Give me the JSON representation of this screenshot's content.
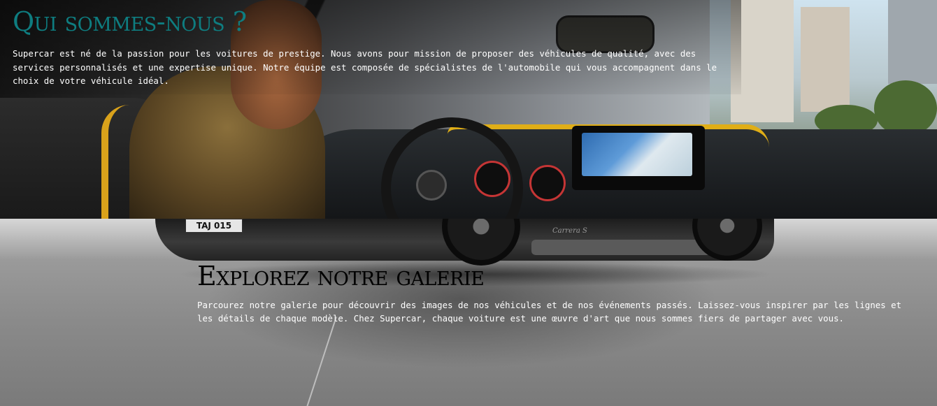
{
  "about": {
    "title": "Qui sommes-nous ?",
    "text": "Supercar est né de la passion pour les voitures de prestige. Nous avons pour mission de proposer des véhicules de qualité, avec des services personnalisés et une expertise unique. Notre équipe est composée de spécialistes de l'automobile qui vous accompagnent dans le choix de votre véhicule idéal."
  },
  "gallery": {
    "title": "Explorez notre galerie",
    "text": "Parcourez notre galerie pour découvrir des images de nos véhicules et de nos événements passés. Laissez-vous inspirer par les lignes et les détails de chaque modèle. Chez Supercar, chaque voiture est une œuvre d'art que nous sommes fiers de partager avec vous.",
    "plate": "TAJ 015",
    "badge": "Carrera S"
  },
  "colors": {
    "title_accent": "#0e7d80",
    "trim_yellow": "#e0ae17"
  }
}
